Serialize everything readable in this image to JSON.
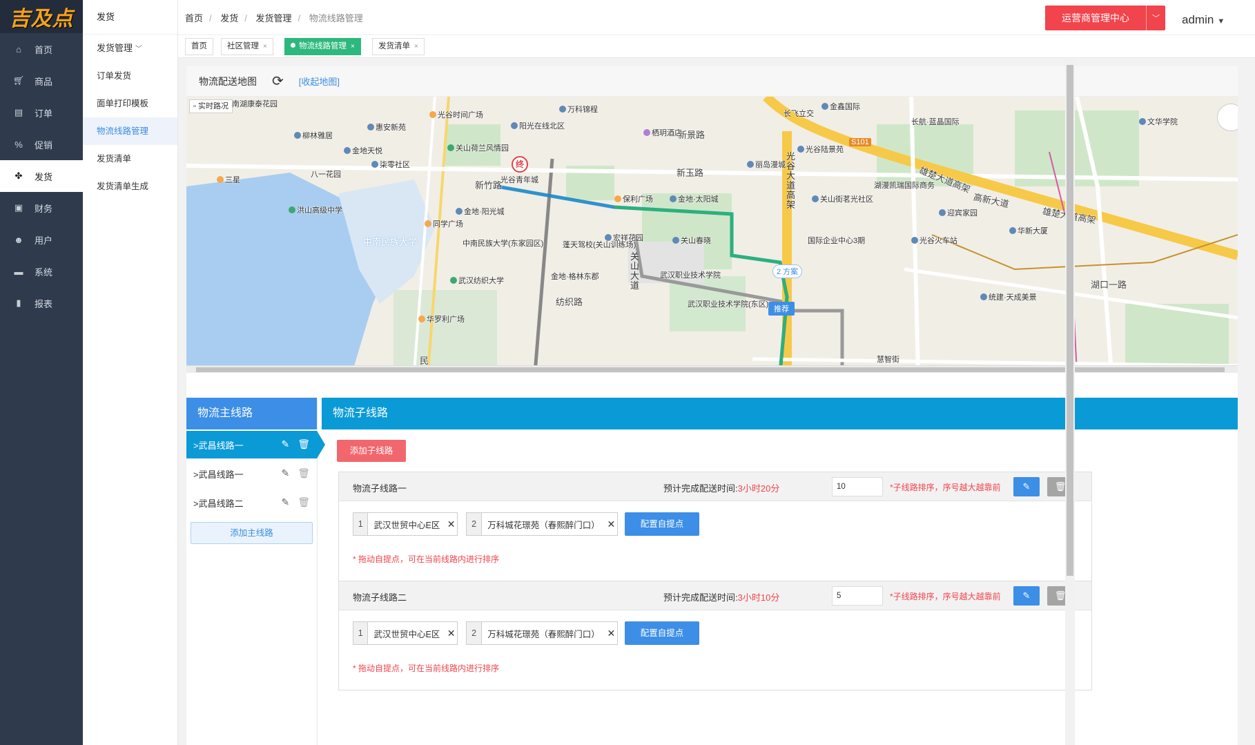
{
  "logo": {
    "text": "吉及点"
  },
  "sidebar": {
    "items": [
      {
        "label": "首页",
        "icon": "home-icon"
      },
      {
        "label": "商品",
        "icon": "cart-icon"
      },
      {
        "label": "订单",
        "icon": "document-icon"
      },
      {
        "label": "促销",
        "icon": "percent-icon"
      },
      {
        "label": "发货",
        "icon": "delivery-icon",
        "active": true
      },
      {
        "label": "财务",
        "icon": "wallet-icon"
      },
      {
        "label": "用户",
        "icon": "user-icon"
      },
      {
        "label": "系统",
        "icon": "monitor-icon"
      },
      {
        "label": "报表",
        "icon": "bar-chart-icon"
      }
    ]
  },
  "subnav": {
    "title": "发货",
    "group_label": "发货管理",
    "items": [
      {
        "label": "订单发货"
      },
      {
        "label": "面单打印模板"
      },
      {
        "label": "物流线路管理",
        "active": true
      },
      {
        "label": "发货清单"
      },
      {
        "label": "发货清单生成"
      }
    ]
  },
  "header": {
    "breadcrumb": [
      "首页",
      "发货",
      "发货管理",
      "物流线路管理"
    ],
    "ops_button": "运营商管理中心",
    "user": "admin"
  },
  "tabs": [
    {
      "label": "首页",
      "closable": false
    },
    {
      "label": "社区管理",
      "closable": true
    },
    {
      "label": "物流线路管理",
      "closable": true,
      "active": true
    },
    {
      "label": "发货清单",
      "closable": true
    }
  ],
  "map_section": {
    "title": "物流配送地图",
    "collapse_link": "[收起地图]",
    "traffic_label": "实时路况",
    "recommend_label": "推荐",
    "plan_label": "2 方案",
    "end_marker": "终",
    "roads": [
      "新竹路",
      "新玉路",
      "新景路",
      "纺织路",
      "雄楚大道高架",
      "高新大道",
      "光谷大道高架",
      "关山大道",
      "雄楚大道高架"
    ],
    "pois": [
      "南湖康泰花园",
      "光谷时间广场",
      "万科锦程",
      "金鑫国际",
      "长飞立交",
      "惠安新苑",
      "阳光在线北区",
      "长航·蓝晶国际",
      "文华学院",
      "柳林雅居",
      "栖玥酒店",
      "光谷陆景苑",
      "金地天悦",
      "柒零社区",
      "关山荷兰风情园",
      "S101",
      "丽岛漫城",
      "八一花园",
      "三星",
      "光谷青年城",
      "保利广场",
      "湖漫凯瑞国际商务",
      "关山街茗光社区",
      "迎宾家园",
      "洪山高级中学",
      "金地·阳光城",
      "金地·太阳城",
      "华新大厦",
      "同学广场",
      "宏祥花园",
      "关山春晓",
      "国际企业中心3期",
      "光谷火车站",
      "中南民族大学",
      "中南民族大学(东家园区)",
      "蓬天驾校(关山训练场)",
      "金地·格林东郡",
      "武汉职业技术学院",
      "武汉纺织大学",
      "武汉职业技术学院(东区)",
      "统建·天成美景",
      "湖口一路",
      "华罗利广场",
      "慧智街",
      "民"
    ]
  },
  "main_routes": {
    "header": "物流主线路",
    "items": [
      {
        "label": ">武昌线路一",
        "active": true
      },
      {
        "label": ">武昌线路一"
      },
      {
        "label": ">武昌线路二"
      }
    ],
    "add_label": "添加主线路"
  },
  "sub_routes": {
    "header": "物流子线路",
    "add_label": "添加子线路",
    "eta_label": "预计完成配送时间:",
    "sort_hint": "*子线路排序，序号越大越靠前",
    "config_label": "配置自提点",
    "drag_note": "* 拖动自提点，可在当前线路内进行排序",
    "routes": [
      {
        "name": "物流子线路一",
        "eta": "3小时20分",
        "sort": "10",
        "stops": [
          {
            "num": "1",
            "name": "武汉世贸中心E区"
          },
          {
            "num": "2",
            "name": "万科城花璟苑（春熙醉门口）"
          }
        ]
      },
      {
        "name": "物流子线路二",
        "eta": "3小时10分",
        "sort": "5",
        "stops": [
          {
            "num": "1",
            "name": "武汉世贸中心E区"
          },
          {
            "num": "2",
            "name": "万科城花璟苑（春熙醉门口）"
          }
        ]
      }
    ]
  },
  "colors": {
    "sidebar_bg": "#2f3b4c",
    "primary_blue": "#3c8ee6",
    "teal_header": "#0a9ad6",
    "danger_red": "#f2444c",
    "tab_green": "#2db87d"
  }
}
